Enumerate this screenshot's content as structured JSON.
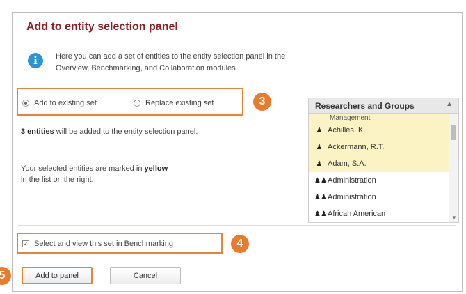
{
  "dialog": {
    "title": "Add to entity selection panel",
    "info_icon": "info-icon",
    "info_line1": "Here you can add a set of entities to the entity selection panel in the",
    "info_line2": "Overview, Benchmarking, and Collaboration modules."
  },
  "mode": {
    "option_add": "Add to existing set",
    "option_replace": "Replace existing set",
    "selected": "Add to existing set"
  },
  "badges": {
    "b3": "3",
    "b4": "4",
    "b5": "5"
  },
  "summary": {
    "count_bold": "3 entities",
    "count_rest": "will be added to the entity selection panel.",
    "selected_prefix": "Your selected entities are marked in",
    "selected_bold": "yellow",
    "selected_line2": "in the list on the right."
  },
  "panel": {
    "header": "Researchers and Groups",
    "collapse_icon": "chevron-up-icon",
    "partial_row": "Management",
    "rows": [
      {
        "label": "Achilles, K.",
        "icon": "person-icon",
        "highlighted": true
      },
      {
        "label": "Ackermann, R.T.",
        "icon": "person-icon",
        "highlighted": true
      },
      {
        "label": "Adam, S.A.",
        "icon": "person-icon",
        "highlighted": true
      },
      {
        "label": "Administration",
        "icon": "group-icon",
        "highlighted": false
      },
      {
        "label": "Administration",
        "icon": "group-icon",
        "highlighted": false
      },
      {
        "label": "African American",
        "icon": "group-icon",
        "highlighted": false
      }
    ]
  },
  "benchmark": {
    "label": "Select and view this set in Benchmarking",
    "checked": true
  },
  "buttons": {
    "add": "Add to panel",
    "cancel": "Cancel"
  },
  "colors": {
    "title": "#8a1f2a",
    "highlight_orange": "#e8833a",
    "badge": "#ec7a2b",
    "info_blue": "#2796d1",
    "selected_yellow": "#fbf3c4"
  }
}
